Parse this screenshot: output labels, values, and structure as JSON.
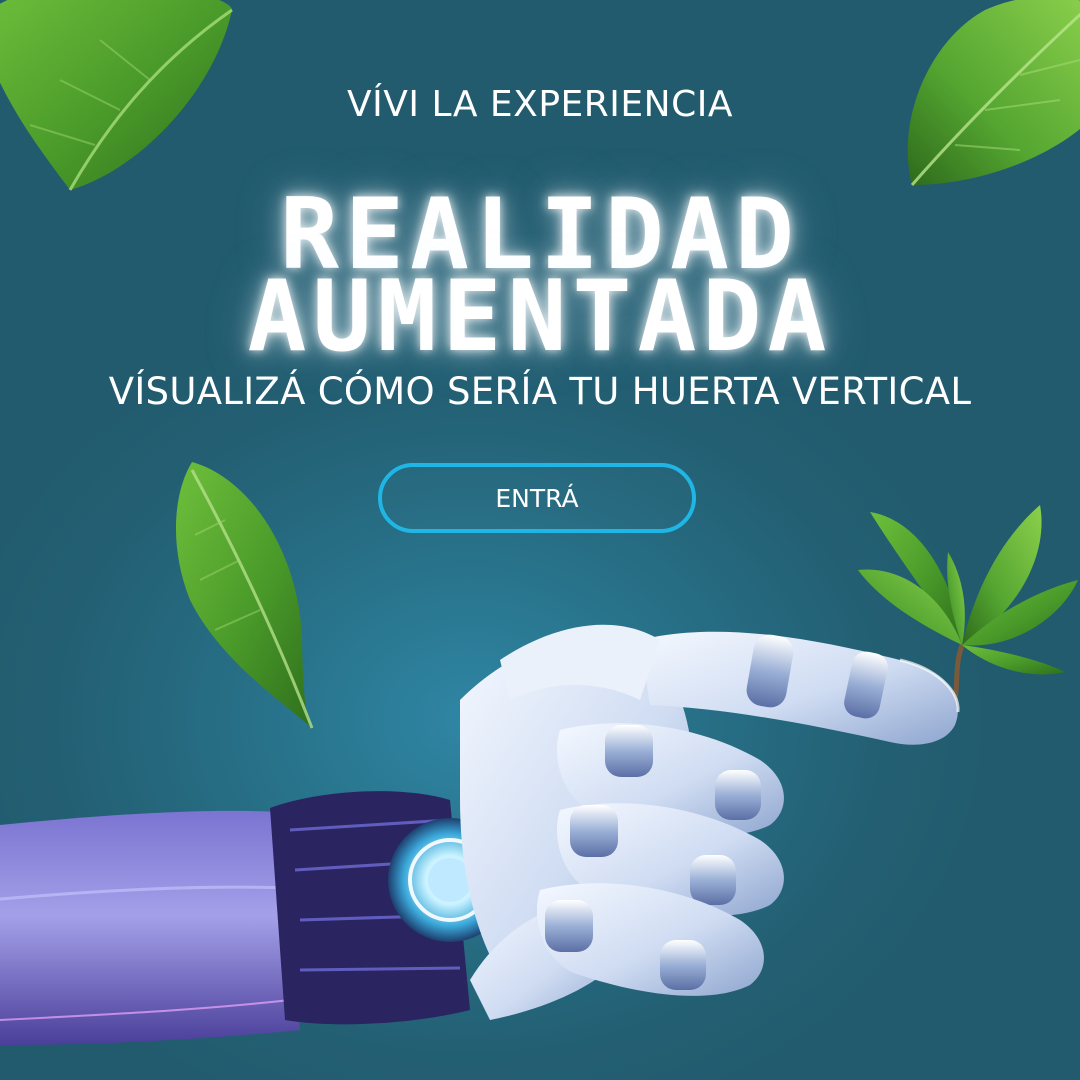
{
  "poster": {
    "eyebrow": "VÍVI LA EXPERIENCIA",
    "headline_line1": "REALIDAD",
    "headline_line2": "AUMENTADA",
    "subtitle": "VÍSUALIZÁ CÓMO SERÍA TU HUERTA VERTICAL",
    "cta_label": "ENTRÁ"
  },
  "colors": {
    "background": "#256073",
    "glow_center": "#2f86a4",
    "cta_border": "#1fb6e6",
    "text": "#ffffff",
    "leaf": "#4e9a2c",
    "robot_metal": "#dfe9f7",
    "robot_arm": "#8a86d6"
  },
  "decor": {
    "leaves": [
      "leaf-top-left-icon",
      "leaf-top-right-icon",
      "leaf-middle-left-icon",
      "sprout-branch-icon"
    ],
    "robot": "robot-hand-icon"
  }
}
